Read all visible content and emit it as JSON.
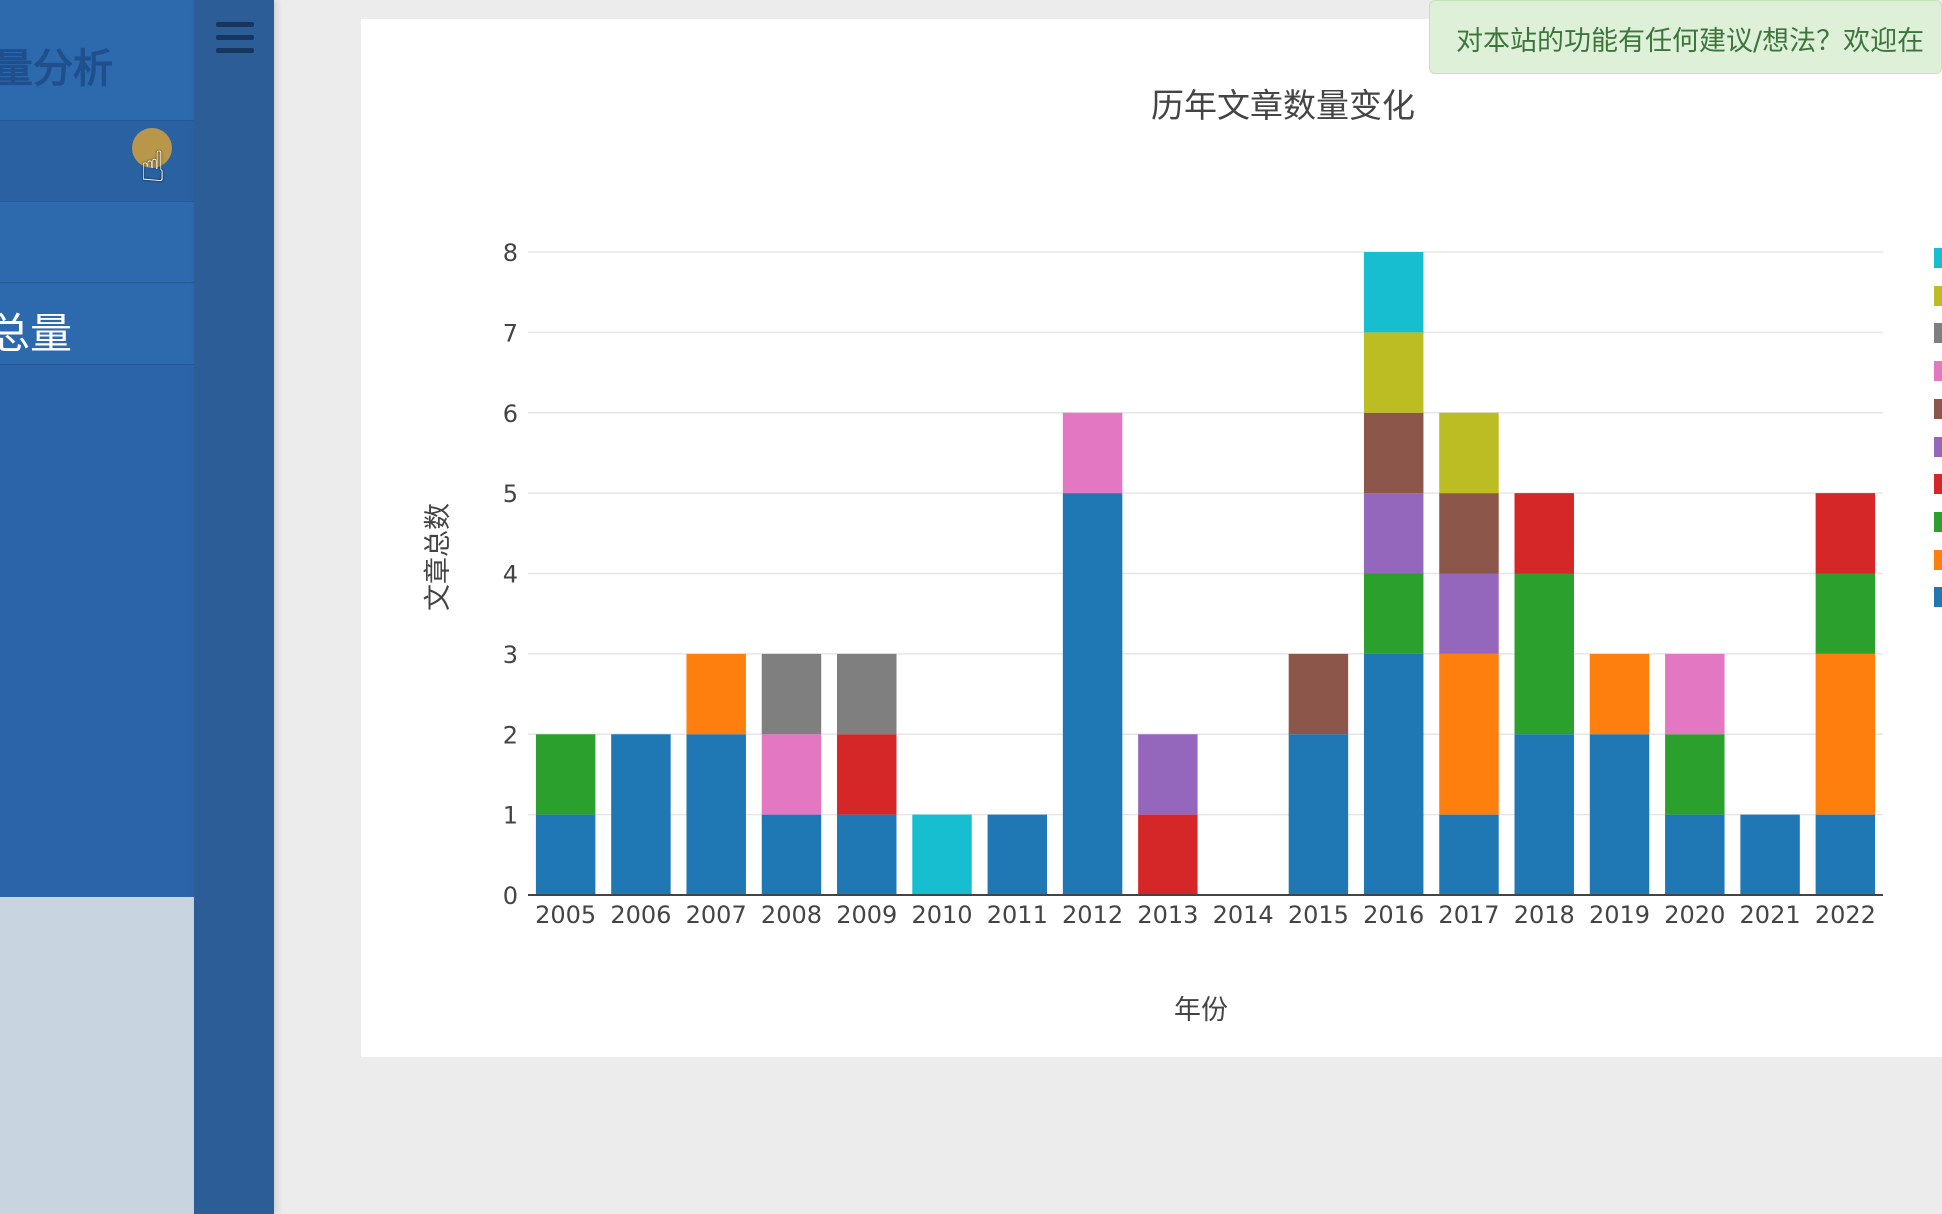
{
  "sidebar": {
    "brand_text": "量分析",
    "menu": [
      {
        "label": ""
      },
      {
        "label": ""
      },
      {
        "label": "总量"
      }
    ]
  },
  "notice": {
    "text": "对本站的功能有任何建议/想法？欢迎在"
  },
  "colors": {
    "sidebar_bg": "#2b64a8",
    "notice_bg": "#dff0d8",
    "notice_text": "#3c763d"
  },
  "chart_data": {
    "type": "bar",
    "stacked": true,
    "title": "历年文章数量变化",
    "xlabel": "年份",
    "ylabel": "文章总数",
    "ylim": [
      0,
      8
    ],
    "yticks": [
      0,
      1,
      2,
      3,
      4,
      5,
      6,
      7,
      8
    ],
    "grid": true,
    "legend_position": "right",
    "categories": [
      "2005",
      "2006",
      "2007",
      "2008",
      "2009",
      "2010",
      "2011",
      "2012",
      "2013",
      "2014",
      "2015",
      "2016",
      "2017",
      "2018",
      "2019",
      "2020",
      "2021",
      "2022"
    ],
    "series": [
      {
        "color": "#1f77b4",
        "values": [
          1,
          2,
          2,
          1,
          1,
          0,
          1,
          5,
          0,
          0,
          2,
          3,
          1,
          2,
          2,
          1,
          1,
          1
        ]
      },
      {
        "color": "#ff7f0e",
        "values": [
          0,
          0,
          1,
          0,
          0,
          0,
          0,
          0,
          0,
          0,
          0,
          0,
          2,
          0,
          1,
          0,
          0,
          2
        ]
      },
      {
        "color": "#2ca02c",
        "values": [
          1,
          0,
          0,
          0,
          0,
          0,
          0,
          0,
          0,
          0,
          0,
          1,
          0,
          2,
          0,
          1,
          0,
          1
        ]
      },
      {
        "color": "#d62728",
        "values": [
          0,
          0,
          0,
          0,
          1,
          0,
          0,
          0,
          1,
          0,
          0,
          0,
          0,
          1,
          0,
          0,
          0,
          1
        ]
      },
      {
        "color": "#9467bd",
        "values": [
          0,
          0,
          0,
          0,
          0,
          0,
          0,
          0,
          1,
          0,
          0,
          1,
          1,
          0,
          0,
          0,
          0,
          0
        ]
      },
      {
        "color": "#8c564b",
        "values": [
          0,
          0,
          0,
          0,
          0,
          0,
          0,
          0,
          0,
          0,
          1,
          1,
          1,
          0,
          0,
          0,
          0,
          0
        ]
      },
      {
        "color": "#e377c2",
        "values": [
          0,
          0,
          0,
          1,
          0,
          0,
          0,
          1,
          0,
          0,
          0,
          0,
          0,
          0,
          0,
          1,
          0,
          0
        ]
      },
      {
        "color": "#7f7f7f",
        "values": [
          0,
          0,
          0,
          1,
          1,
          0,
          0,
          0,
          0,
          0,
          0,
          0,
          0,
          0,
          0,
          0,
          0,
          0
        ]
      },
      {
        "color": "#bcbd22",
        "values": [
          0,
          0,
          0,
          0,
          0,
          0,
          0,
          0,
          0,
          0,
          0,
          1,
          1,
          0,
          0,
          0,
          0,
          0
        ]
      },
      {
        "color": "#17becf",
        "values": [
          0,
          0,
          0,
          0,
          0,
          1,
          0,
          0,
          0,
          0,
          0,
          1,
          0,
          0,
          0,
          0,
          0,
          0
        ]
      }
    ]
  }
}
